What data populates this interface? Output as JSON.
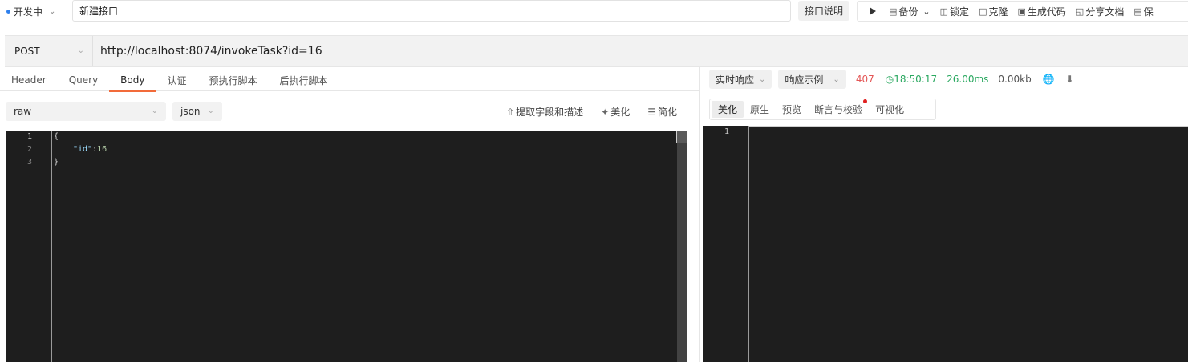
{
  "topbar": {
    "status": "开发中",
    "name": "新建接口",
    "doc_button": "接口说明",
    "toolbar": {
      "run_icon": "play-icon",
      "backup": "备份",
      "lock": "锁定",
      "clone": "克隆",
      "gen_code": "生成代码",
      "share": "分享文档",
      "save": "保"
    }
  },
  "request": {
    "method": "POST",
    "url": "http://localhost:8074/invokeTask?id=16"
  },
  "tabs": [
    "Header",
    "Query",
    "Body",
    "认证",
    "预执行脚本",
    "后执行脚本"
  ],
  "active_tab": "Body",
  "body": {
    "mode": "raw",
    "format": "json",
    "actions": {
      "extract": "提取字段和描述",
      "beautify": "美化",
      "simplify": "简化"
    },
    "line_numbers": [
      "1",
      "2",
      "3"
    ],
    "code": {
      "open": "{",
      "key": "\"id\"",
      "colon": ":",
      "value": "16",
      "close": "}"
    }
  },
  "response": {
    "mode": "实时响应",
    "example": "响应示例",
    "status_code": "407",
    "time": "18:50:17",
    "duration": "26.00ms",
    "size": "0.00kb",
    "tabs": [
      "美化",
      "原生",
      "预览",
      "断言与校验",
      "可视化"
    ],
    "active_tab": "美化",
    "line_numbers": [
      "1"
    ]
  },
  "colors": {
    "accent": "#f26b3a",
    "error": "#e45757",
    "success": "#2aa860",
    "editor_bg": "#1e1e1e"
  }
}
